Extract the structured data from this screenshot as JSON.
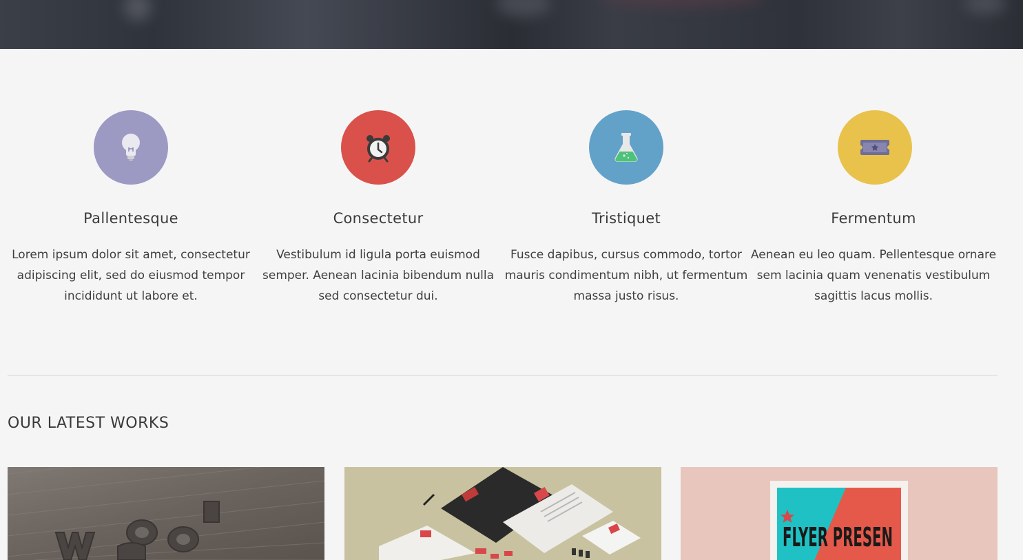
{
  "features": [
    {
      "icon": "lightbulb-icon",
      "color": "#9c99c3",
      "title": "Pallentesque",
      "text": "Lorem ipsum dolor sit amet, consectetur adipiscing elit, sed do eiusmod tempor incididunt ut labore et."
    },
    {
      "icon": "alarm-clock-icon",
      "color": "#d9514a",
      "title": "Consectetur",
      "text": "Vestibulum id ligula porta euismod semper. Aenean lacinia bibendum nulla sed consectetur dui."
    },
    {
      "icon": "flask-icon",
      "color": "#62a2c9",
      "title": "Tristiquet",
      "text": "Fusce dapibus, cursus commodo, tortor mauris condimentum nibh, ut fermentum massa justo risus."
    },
    {
      "icon": "ticket-icon",
      "color": "#e9c24c",
      "title": "Fermentum",
      "text": "Aenean eu leo quam. Pellentesque ornare sem lacinia quam venenatis vestibulum sagittis lacus mollis."
    }
  ],
  "latest_works": {
    "title": "OUR LATEST WORKS",
    "items": [
      {
        "name": "wood-letters-photo"
      },
      {
        "name": "stationery-mockup-photo"
      },
      {
        "name": "flyer-mockup-photo",
        "caption": "FLYER PRESEN"
      }
    ]
  }
}
